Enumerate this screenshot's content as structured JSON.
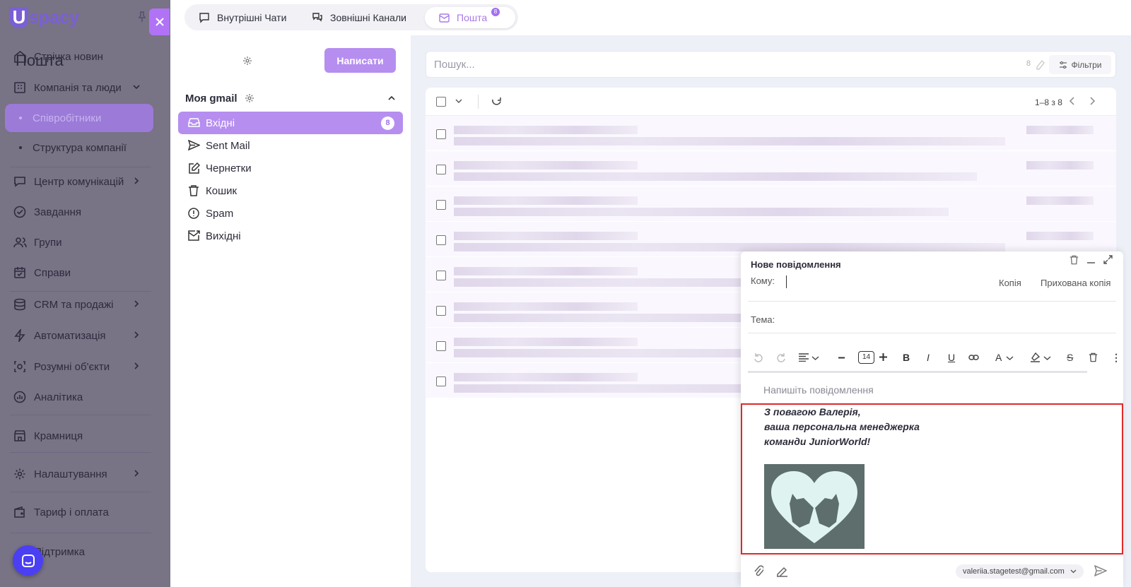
{
  "brand": {
    "logo_letter": "U",
    "logo_text": "spacy",
    "accent": "#b68ef0"
  },
  "sidebar": {
    "items": [
      {
        "label": "Стрічка новин",
        "icon": "home-icon"
      },
      {
        "label": "Компанія та люди",
        "icon": "building-icon"
      },
      {
        "label": "Співробітники",
        "icon": "dot"
      },
      {
        "label": "Структура компанії",
        "icon": "dot"
      },
      {
        "label": "Центр комунікацій",
        "icon": "chat-icon"
      },
      {
        "label": "Завдання",
        "icon": "check-icon"
      },
      {
        "label": "Групи",
        "icon": "users-icon"
      },
      {
        "label": "Справи",
        "icon": "calendar-icon"
      },
      {
        "label": "CRM та продажі",
        "icon": "database-icon"
      },
      {
        "label": "Автоматизація",
        "icon": "bolt-icon"
      },
      {
        "label": "Розумні об'єкти",
        "icon": "smart-icon"
      },
      {
        "label": "Аналітика",
        "icon": "chart-icon"
      },
      {
        "label": "Крамниця",
        "icon": "store-icon"
      },
      {
        "label": "Налаштування",
        "icon": "gear-icon"
      },
      {
        "label": "Тариф і оплата",
        "icon": "wallet-icon"
      },
      {
        "label": "Підтримка",
        "icon": "support-icon"
      }
    ]
  },
  "topbar": {
    "tabs": [
      {
        "label": "Внутрішні Чати"
      },
      {
        "label": "Зовнішні Канали"
      },
      {
        "label": "Пошта",
        "badge": "8"
      }
    ]
  },
  "mail": {
    "title": "Пошта",
    "write_label": "Написати",
    "account": "Моя gmail",
    "folders": [
      {
        "label": "Вхідні",
        "badge": "8"
      },
      {
        "label": "Sent Mail"
      },
      {
        "label": "Чернетки"
      },
      {
        "label": "Кошик"
      },
      {
        "label": "Spam"
      },
      {
        "label": "Вихідні"
      }
    ]
  },
  "search": {
    "placeholder": "Пошук...",
    "count": "8",
    "filters_label": "Фільтри"
  },
  "list": {
    "pager": "1–8 з 8",
    "row_count": 8
  },
  "compose": {
    "title": "Нове повідомлення",
    "to_label": "Кому:",
    "cc_label": "Копія",
    "bcc_label": "Прихована копія",
    "subject_label": "Тема:",
    "font_size": "14",
    "body_placeholder": "Напишіть повідомлення",
    "signature": [
      "З повагою Валерія,",
      "ваша персональна менеджерка",
      "команди JuniorWorld!"
    ],
    "from": "valeriia.stagetest@gmail.com"
  }
}
